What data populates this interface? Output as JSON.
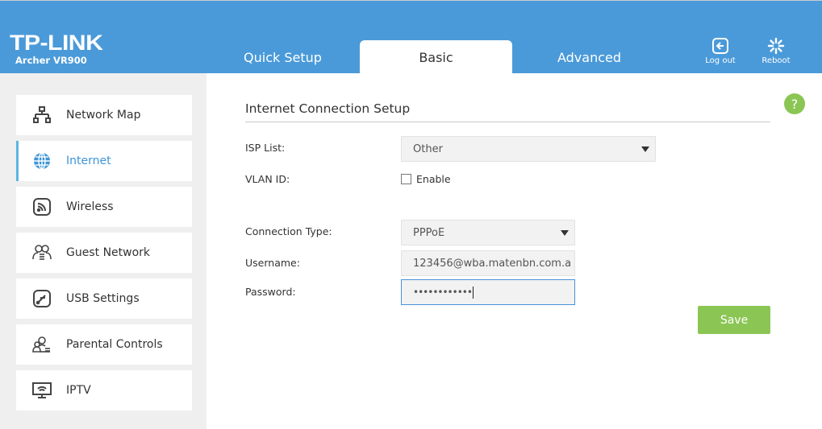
{
  "brand": {
    "logo": "TP-LINK",
    "model": "Archer VR900",
    "header_color": "#4a9ad9"
  },
  "tabs": [
    {
      "label": "Quick Setup",
      "active": false
    },
    {
      "label": "Basic",
      "active": true
    },
    {
      "label": "Advanced",
      "active": false
    }
  ],
  "header_actions": {
    "logout": {
      "label": "Log out",
      "icon": "logout-icon"
    },
    "reboot": {
      "label": "Reboot",
      "icon": "reboot-icon"
    }
  },
  "sidebar": {
    "items": [
      {
        "label": "Network Map",
        "icon": "network-map-icon",
        "active": false
      },
      {
        "label": "Internet",
        "icon": "globe-icon",
        "active": true
      },
      {
        "label": "Wireless",
        "icon": "wireless-icon",
        "active": false
      },
      {
        "label": "Guest Network",
        "icon": "guest-network-icon",
        "active": false
      },
      {
        "label": "USB Settings",
        "icon": "usb-icon",
        "active": false
      },
      {
        "label": "Parental Controls",
        "icon": "parental-controls-icon",
        "active": false
      },
      {
        "label": "IPTV",
        "icon": "iptv-icon",
        "active": false
      }
    ]
  },
  "main": {
    "title": "Internet Connection Setup",
    "help_label": "?",
    "form": {
      "isp_list": {
        "label": "ISP List:",
        "value": "Other"
      },
      "vlan_id": {
        "label": "VLAN ID:",
        "checkbox_label": "Enable",
        "checked": false
      },
      "connection_type": {
        "label": "Connection Type:",
        "value": "PPPoE"
      },
      "username": {
        "label": "Username:",
        "value": "123456@wba.matenbn.com.a"
      },
      "password": {
        "label": "Password:",
        "value": "••••••••••••"
      }
    },
    "save_label": "Save",
    "accent_green": "#8bc655"
  }
}
